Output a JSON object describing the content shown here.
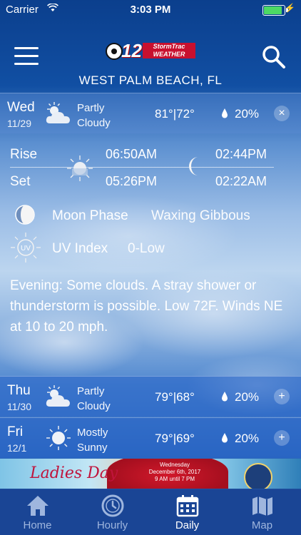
{
  "status_bar": {
    "carrier": "Carrier",
    "time": "3:03 PM",
    "battery_level": 0.95
  },
  "header": {
    "logo_number": "12",
    "logo_tag_line1": "StormTrac",
    "logo_tag_line2": "WEATHER",
    "location": "WEST PALM BEACH, FL"
  },
  "days": [
    {
      "day": "Wed",
      "date": "11/29",
      "cond1": "Partly",
      "cond2": "Cloudy",
      "temps": "81°|72°",
      "precip": "20%",
      "icon": "partly-cloudy-icon",
      "toggle": "×"
    },
    {
      "day": "Thu",
      "date": "11/30",
      "cond1": "Partly",
      "cond2": "Cloudy",
      "temps": "79°|68°",
      "precip": "20%",
      "icon": "partly-cloudy-icon",
      "toggle": "+"
    },
    {
      "day": "Fri",
      "date": "12/1",
      "cond1": "Mostly",
      "cond2": "Sunny",
      "temps": "79°|69°",
      "precip": "20%",
      "icon": "sun-icon",
      "toggle": "+"
    }
  ],
  "details": {
    "rise_label": "Rise",
    "set_label": "Set",
    "sunrise": "06:50AM",
    "sunset": "05:26PM",
    "moonrise": "02:44PM",
    "moonset": "02:22AM",
    "moon_phase_label": "Moon Phase",
    "moon_phase_value": "Waxing Gibbous",
    "uv_label": "UV Index",
    "uv_value": "0-Low",
    "uv_badge": "UV",
    "forecast": "Evening: Some clouds. A stray shower or thunderstorm is possible. Low 72F. Winds NE at 10 to 20 mph."
  },
  "ad": {
    "title": "Ladies Day",
    "line1": "Wednesday",
    "line2": "December 6th, 2017",
    "line3": "9 AM until 7 PM"
  },
  "tabs": [
    {
      "label": "Home",
      "icon": "home-icon",
      "active": false
    },
    {
      "label": "Hourly",
      "icon": "clock-icon",
      "active": false
    },
    {
      "label": "Daily",
      "icon": "calendar-icon",
      "active": true
    },
    {
      "label": "Map",
      "icon": "map-icon",
      "active": false
    }
  ]
}
